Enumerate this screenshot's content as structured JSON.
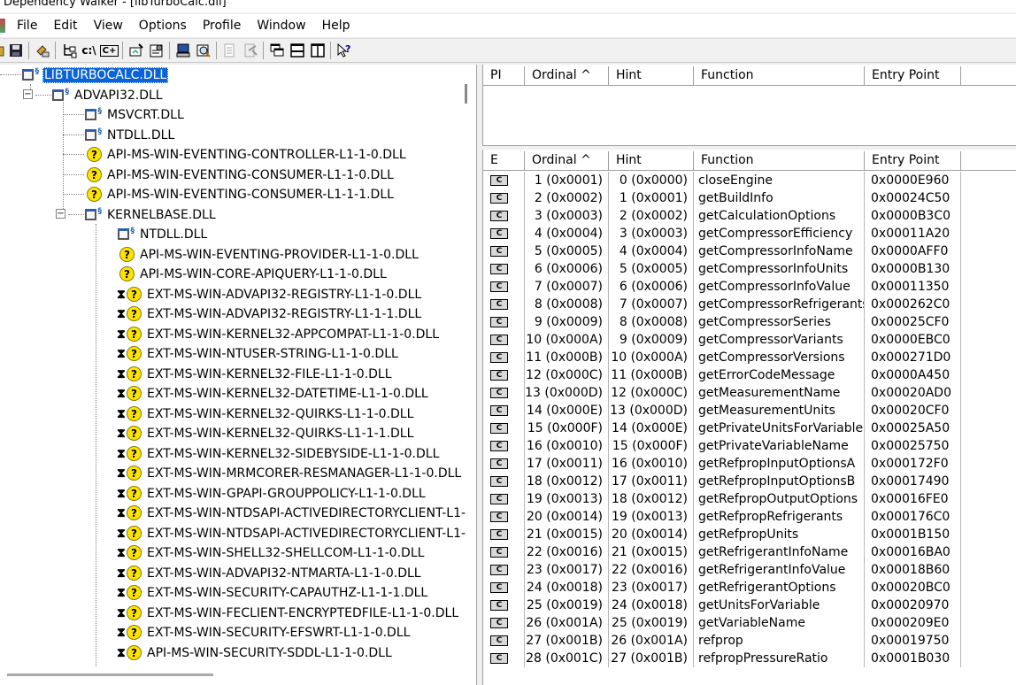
{
  "window": {
    "title": "Dependency Walker - [libTurboCalc.dll]"
  },
  "menu": [
    "File",
    "Edit",
    "View",
    "Options",
    "Profile",
    "Window",
    "Help"
  ],
  "toolbar": {
    "buttons": [
      "open-icon",
      "save-icon",
      "copy-icon",
      "autoexpand-icon",
      "full-paths-icon",
      "undecorate-icon",
      "configure-module-search-icon",
      "properties-icon",
      "system-info-icon",
      "find-icon",
      "find-next-icon",
      "highlight-matching-item-icon",
      "cascade-icon",
      "tile-horizontal-icon",
      "tile-vertical-icon",
      "help-icon"
    ],
    "search_button_label": "c:\\",
    "cmdline_button_label": "C+"
  },
  "tree": {
    "root": "LIBTURBOCALC.DLL",
    "nodes": [
      {
        "label": "ADVAPI32.DLL",
        "icon": "module-icon"
      },
      {
        "label": "MSVCRT.DLL",
        "icon": "module-icon"
      },
      {
        "label": "NTDLL.DLL",
        "icon": "module-icon"
      },
      {
        "label": "API-MS-WIN-EVENTING-CONTROLLER-L1-1-0.DLL",
        "icon": "missing-icon"
      },
      {
        "label": "API-MS-WIN-EVENTING-CONSUMER-L1-1-0.DLL",
        "icon": "missing-icon"
      },
      {
        "label": "API-MS-WIN-EVENTING-CONSUMER-L1-1-1.DLL",
        "icon": "missing-icon"
      },
      {
        "label": "KERNELBASE.DLL",
        "icon": "module-icon"
      },
      {
        "label": "NTDLL.DLL",
        "icon": "module-icon"
      },
      {
        "label": "API-MS-WIN-EVENTING-PROVIDER-L1-1-0.DLL",
        "icon": "missing-icon"
      },
      {
        "label": "API-MS-WIN-CORE-APIQUERY-L1-1-0.DLL",
        "icon": "missing-icon"
      },
      {
        "label": "EXT-MS-WIN-ADVAPI32-REGISTRY-L1-1-0.DLL",
        "icon": "delayload-missing-icon"
      },
      {
        "label": "EXT-MS-WIN-ADVAPI32-REGISTRY-L1-1-1.DLL",
        "icon": "delayload-missing-icon"
      },
      {
        "label": "EXT-MS-WIN-KERNEL32-APPCOMPAT-L1-1-0.DLL",
        "icon": "delayload-missing-icon"
      },
      {
        "label": "EXT-MS-WIN-NTUSER-STRING-L1-1-0.DLL",
        "icon": "delayload-missing-icon"
      },
      {
        "label": "EXT-MS-WIN-KERNEL32-FILE-L1-1-0.DLL",
        "icon": "delayload-missing-icon"
      },
      {
        "label": "EXT-MS-WIN-KERNEL32-DATETIME-L1-1-0.DLL",
        "icon": "delayload-missing-icon"
      },
      {
        "label": "EXT-MS-WIN-KERNEL32-QUIRKS-L1-1-0.DLL",
        "icon": "delayload-missing-icon"
      },
      {
        "label": "EXT-MS-WIN-KERNEL32-QUIRKS-L1-1-1.DLL",
        "icon": "delayload-missing-icon"
      },
      {
        "label": "EXT-MS-WIN-KERNEL32-SIDEBYSIDE-L1-1-0.DLL",
        "icon": "delayload-missing-icon"
      },
      {
        "label": "EXT-MS-WIN-MRMCORER-RESMANAGER-L1-1-0.DLL",
        "icon": "delayload-missing-icon"
      },
      {
        "label": "EXT-MS-WIN-GPAPI-GROUPPOLICY-L1-1-0.DLL",
        "icon": "delayload-missing-icon"
      },
      {
        "label": "EXT-MS-WIN-NTDSAPI-ACTIVEDIRECTORYCLIENT-L1-",
        "icon": "delayload-missing-icon"
      },
      {
        "label": "EXT-MS-WIN-NTDSAPI-ACTIVEDIRECTORYCLIENT-L1-",
        "icon": "delayload-missing-icon"
      },
      {
        "label": "EXT-MS-WIN-SHELL32-SHELLCOM-L1-1-0.DLL",
        "icon": "delayload-missing-icon"
      },
      {
        "label": "EXT-MS-WIN-ADVAPI32-NTMARTA-L1-1-0.DLL",
        "icon": "delayload-missing-icon"
      },
      {
        "label": "EXT-MS-WIN-SECURITY-CAPAUTHZ-L1-1-1.DLL",
        "icon": "delayload-missing-icon"
      },
      {
        "label": "EXT-MS-WIN-FECLIENT-ENCRYPTEDFILE-L1-1-0.DLL",
        "icon": "delayload-missing-icon"
      },
      {
        "label": "EXT-MS-WIN-SECURITY-EFSWRT-L1-1-0.DLL",
        "icon": "delayload-missing-icon"
      },
      {
        "label": "API-MS-WIN-SECURITY-SDDL-L1-1-0.DLL",
        "icon": "delayload-missing-icon"
      }
    ]
  },
  "imports": {
    "columns": [
      "PI",
      "Ordinal ^",
      "Hint",
      "Function",
      "Entry Point"
    ]
  },
  "exports": {
    "columns": [
      "E",
      "Ordinal ^",
      "Hint",
      "Function",
      "Entry Point"
    ],
    "c_icon_label": "C",
    "rows": [
      {
        "ordinal": "1 (0x0001)",
        "hint": "0 (0x0000)",
        "function": "closeEngine",
        "entry": "0x0000E960"
      },
      {
        "ordinal": "2 (0x0002)",
        "hint": "1 (0x0001)",
        "function": "getBuildInfo",
        "entry": "0x00024C50"
      },
      {
        "ordinal": "3 (0x0003)",
        "hint": "2 (0x0002)",
        "function": "getCalculationOptions",
        "entry": "0x0000B3C0"
      },
      {
        "ordinal": "4 (0x0004)",
        "hint": "3 (0x0003)",
        "function": "getCompressorEfficiency",
        "entry": "0x00011A20"
      },
      {
        "ordinal": "5 (0x0005)",
        "hint": "4 (0x0004)",
        "function": "getCompressorInfoName",
        "entry": "0x0000AFF0"
      },
      {
        "ordinal": "6 (0x0006)",
        "hint": "5 (0x0005)",
        "function": "getCompressorInfoUnits",
        "entry": "0x0000B130"
      },
      {
        "ordinal": "7 (0x0007)",
        "hint": "6 (0x0006)",
        "function": "getCompressorInfoValue",
        "entry": "0x00011350"
      },
      {
        "ordinal": "8 (0x0008)",
        "hint": "7 (0x0007)",
        "function": "getCompressorRefrigerants",
        "entry": "0x000262C0"
      },
      {
        "ordinal": "9 (0x0009)",
        "hint": "8 (0x0008)",
        "function": "getCompressorSeries",
        "entry": "0x00025CF0"
      },
      {
        "ordinal": "10 (0x000A)",
        "hint": "9 (0x0009)",
        "function": "getCompressorVariants",
        "entry": "0x0000EBC0"
      },
      {
        "ordinal": "11 (0x000B)",
        "hint": "10 (0x000A)",
        "function": "getCompressorVersions",
        "entry": "0x000271D0"
      },
      {
        "ordinal": "12 (0x000C)",
        "hint": "11 (0x000B)",
        "function": "getErrorCodeMessage",
        "entry": "0x0000A450"
      },
      {
        "ordinal": "13 (0x000D)",
        "hint": "12 (0x000C)",
        "function": "getMeasurementName",
        "entry": "0x00020AD0"
      },
      {
        "ordinal": "14 (0x000E)",
        "hint": "13 (0x000D)",
        "function": "getMeasurementUnits",
        "entry": "0x00020CF0"
      },
      {
        "ordinal": "15 (0x000F)",
        "hint": "14 (0x000E)",
        "function": "getPrivateUnitsForVariable",
        "entry": "0x00025A50"
      },
      {
        "ordinal": "16 (0x0010)",
        "hint": "15 (0x000F)",
        "function": "getPrivateVariableName",
        "entry": "0x00025750"
      },
      {
        "ordinal": "17 (0x0011)",
        "hint": "16 (0x0010)",
        "function": "getRefpropInputOptionsA",
        "entry": "0x000172F0"
      },
      {
        "ordinal": "18 (0x0012)",
        "hint": "17 (0x0011)",
        "function": "getRefpropInputOptionsB",
        "entry": "0x00017490"
      },
      {
        "ordinal": "19 (0x0013)",
        "hint": "18 (0x0012)",
        "function": "getRefpropOutputOptions",
        "entry": "0x00016FE0"
      },
      {
        "ordinal": "20 (0x0014)",
        "hint": "19 (0x0013)",
        "function": "getRefpropRefrigerants",
        "entry": "0x000176C0"
      },
      {
        "ordinal": "21 (0x0015)",
        "hint": "20 (0x0014)",
        "function": "getRefpropUnits",
        "entry": "0x0001B150"
      },
      {
        "ordinal": "22 (0x0016)",
        "hint": "21 (0x0015)",
        "function": "getRefrigerantInfoName",
        "entry": "0x00016BA0"
      },
      {
        "ordinal": "23 (0x0017)",
        "hint": "22 (0x0016)",
        "function": "getRefrigerantInfoValue",
        "entry": "0x00018B60"
      },
      {
        "ordinal": "24 (0x0018)",
        "hint": "23 (0x0017)",
        "function": "getRefrigerantOptions",
        "entry": "0x00020BC0"
      },
      {
        "ordinal": "25 (0x0019)",
        "hint": "24 (0x0018)",
        "function": "getUnitsForVariable",
        "entry": "0x00020970"
      },
      {
        "ordinal": "26 (0x001A)",
        "hint": "25 (0x0019)",
        "function": "getVariableName",
        "entry": "0x000209E0"
      },
      {
        "ordinal": "27 (0x001B)",
        "hint": "26 (0x001A)",
        "function": "refprop",
        "entry": "0x00019750"
      },
      {
        "ordinal": "28 (0x001C)",
        "hint": "27 (0x001B)",
        "function": "refpropPressureRatio",
        "entry": "0x0001B030"
      }
    ]
  }
}
